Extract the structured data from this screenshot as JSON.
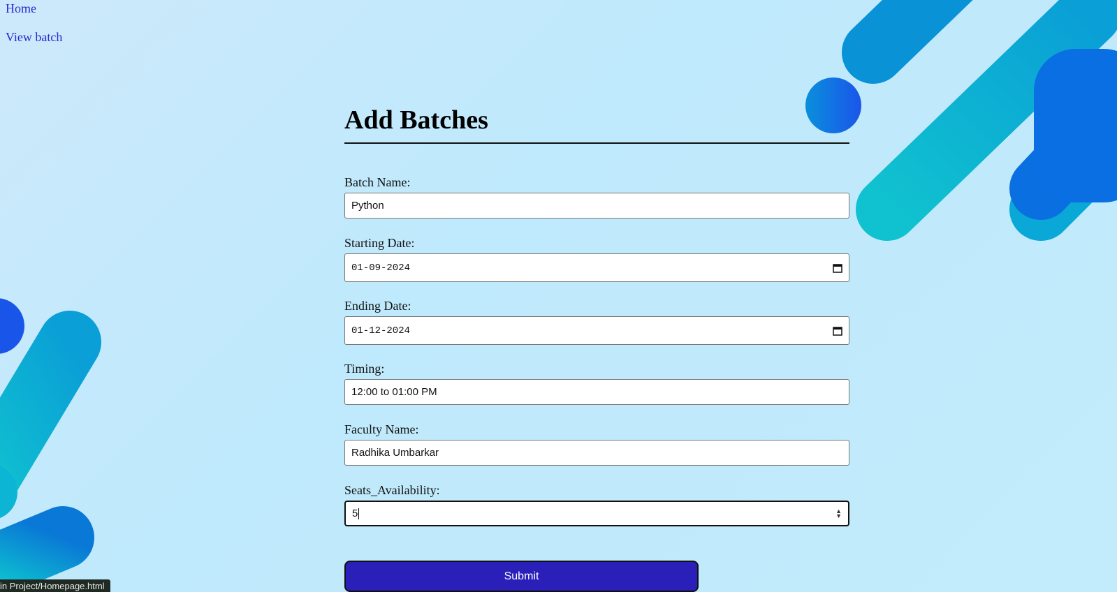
{
  "nav": {
    "home_label": "Home",
    "view_label": "View batch"
  },
  "form": {
    "title": "Add Batches",
    "batch_name": {
      "label": "Batch Name:",
      "value": "Python"
    },
    "starting_date": {
      "label": "Starting Date:",
      "value": "01-09-2024"
    },
    "ending_date": {
      "label": "Ending Date:",
      "value": "01-12-2024"
    },
    "timing": {
      "label": "Timing:",
      "value": "12:00 to 01:00 PM"
    },
    "faculty_name": {
      "label": "Faculty Name:",
      "value": "Radhika Umbarkar"
    },
    "seats": {
      "label": "Seats_Availability:",
      "value": "5"
    },
    "submit_label": "Submit"
  },
  "status_bar": {
    "text": "in Project/Homepage.html"
  },
  "colors": {
    "link": "#2a2ad0",
    "submit_bg": "#2a1fb8",
    "background": "#c2ecfb"
  }
}
